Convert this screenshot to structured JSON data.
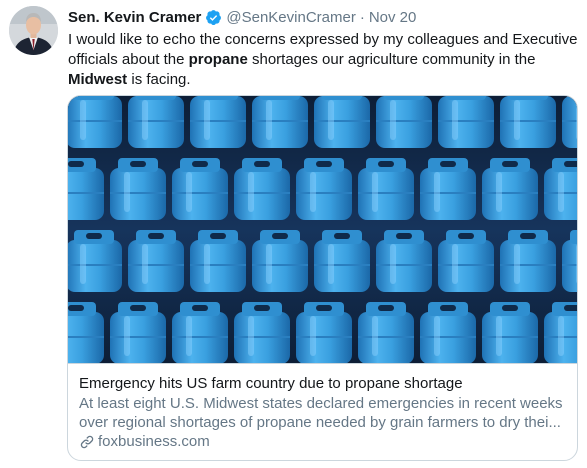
{
  "author": {
    "name": "Sen. Kevin Cramer",
    "handle": "@SenKevinCramer",
    "separator": "·",
    "date": "Nov 20",
    "verified_icon": "verified-badge-icon",
    "verified_color": "#1da1f2"
  },
  "tweet": {
    "part1": "I would like to echo the concerns expressed by my colleagues and Executive officials about the ",
    "bold1": "propane",
    "part2": " shortages our agriculture community in the ",
    "bold2": "Midwest",
    "part3": " is facing."
  },
  "card": {
    "image_icon": "propane-tanks-photo",
    "title": "Emergency hits US farm country due to propane shortage",
    "description_line1": "At least eight U.S. Midwest states declared emergencies in recent weeks",
    "description_line2": "over regional shortages of propane needed by grain farmers to dry thei...",
    "domain": "foxbusiness.com",
    "link_icon": "link-icon"
  },
  "colors": {
    "text_primary": "#14171a",
    "text_secondary": "#657786",
    "border": "#ccd6dd",
    "tank_blue": "#3aa0e0",
    "tank_dark": "#12294a"
  }
}
